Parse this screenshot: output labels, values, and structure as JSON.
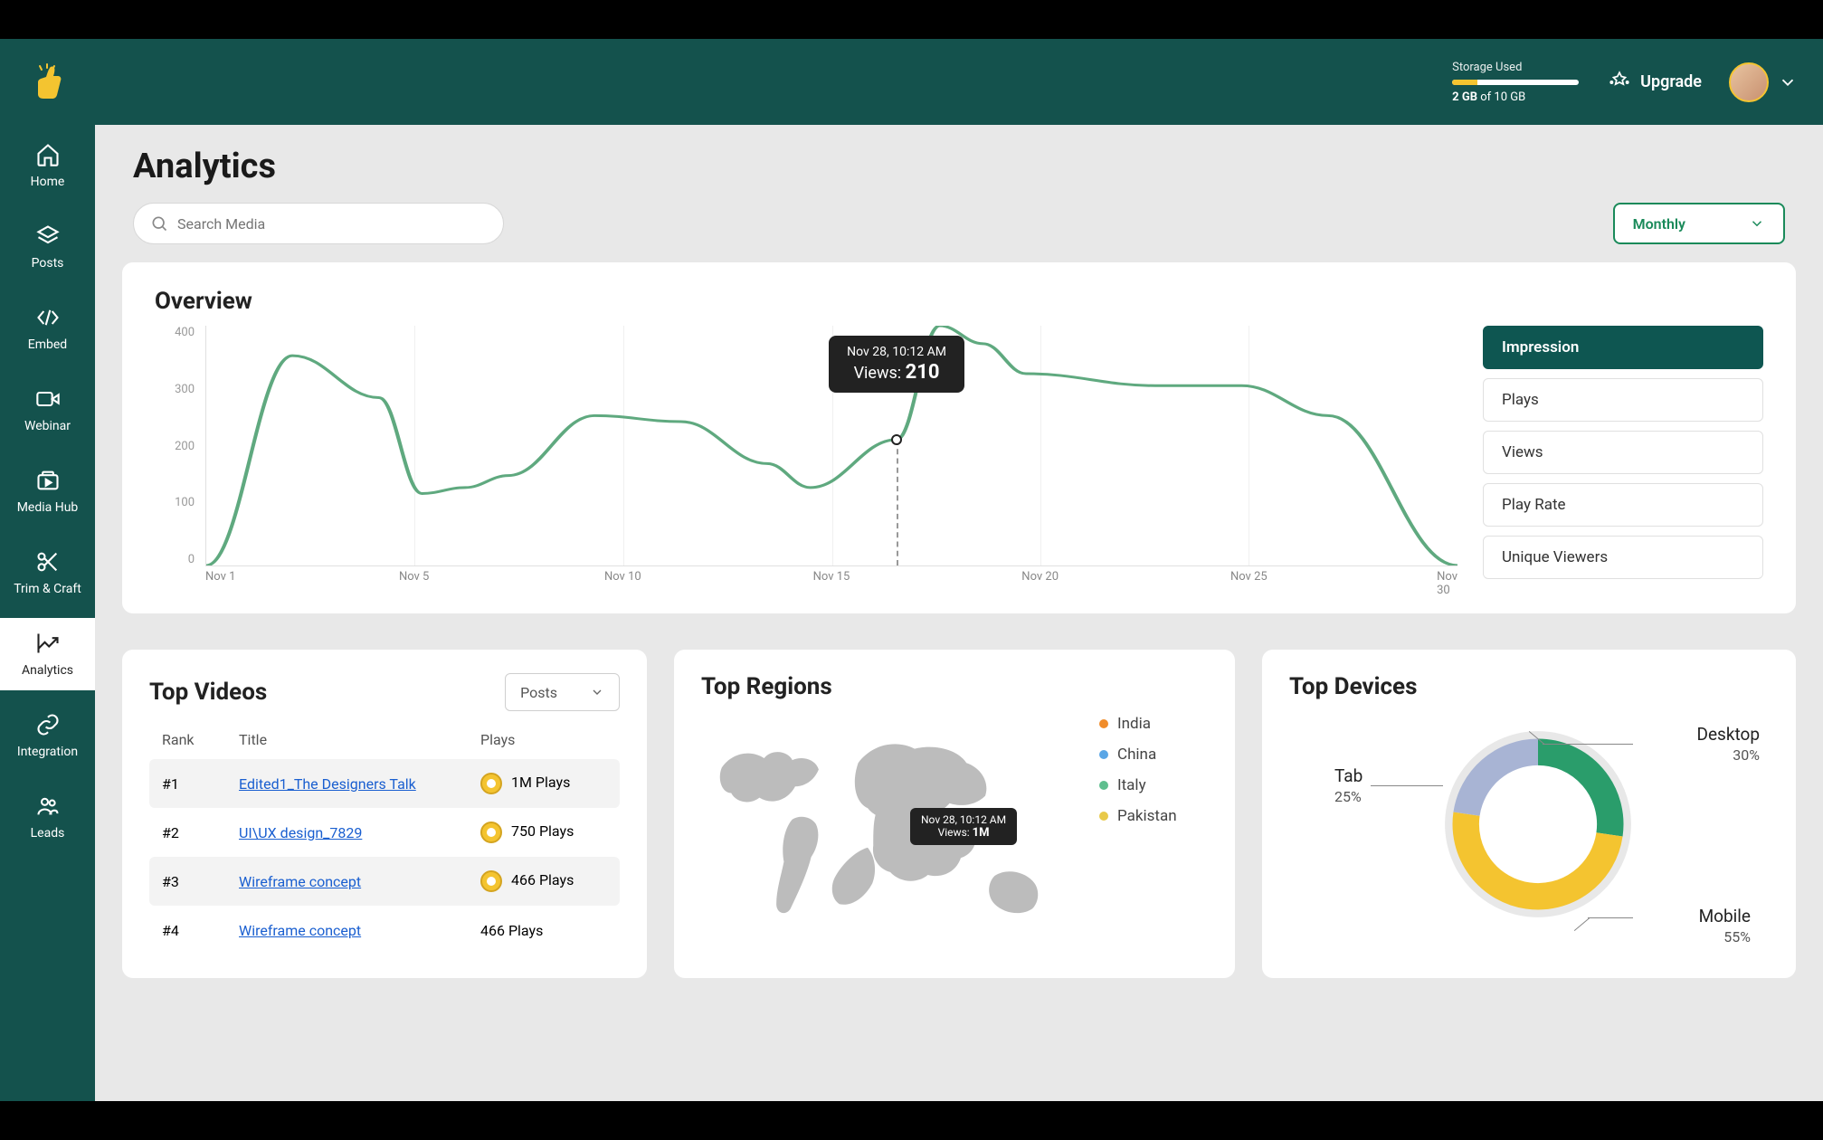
{
  "header": {
    "storage_label": "Storage Used",
    "storage_used": "2 GB",
    "storage_of": " of 10 GB",
    "storage_pct": 20,
    "upgrade": "Upgrade"
  },
  "sidebar": {
    "items": [
      {
        "label": "Home"
      },
      {
        "label": "Posts"
      },
      {
        "label": "Embed"
      },
      {
        "label": "Webinar"
      },
      {
        "label": "Media Hub"
      },
      {
        "label": "Trim & Craft"
      },
      {
        "label": "Analytics"
      },
      {
        "label": "Integration"
      },
      {
        "label": "Leads"
      }
    ]
  },
  "page": {
    "title": "Analytics",
    "search_placeholder": "Search Media",
    "period": "Monthly"
  },
  "overview": {
    "title": "Overview",
    "metrics": [
      "Impression",
      "Plays",
      "Views",
      "Play Rate",
      "Unique Viewers"
    ],
    "tooltip": {
      "time": "Nov 28, 10:12 AM",
      "label": "Views: ",
      "value": "210"
    }
  },
  "chart_data": {
    "type": "line",
    "title": "Overview",
    "xlabel": "",
    "ylabel": "",
    "ylim": [
      0,
      400
    ],
    "y_ticks": [
      400,
      300,
      200,
      100,
      0
    ],
    "categories": [
      "Nov 1",
      "Nov 5",
      "Nov 10",
      "Nov 15",
      "Nov 20",
      "Nov 25",
      "Nov 30"
    ],
    "x_days": [
      1,
      3,
      5,
      6,
      7,
      8,
      10,
      12,
      14,
      15,
      17,
      18,
      19,
      20,
      23,
      25,
      27,
      30
    ],
    "values": [
      0,
      350,
      280,
      120,
      130,
      150,
      250,
      240,
      170,
      130,
      210,
      400,
      370,
      320,
      300,
      300,
      250,
      0
    ],
    "tooltip_point": {
      "x_day": 17,
      "value": 210,
      "time": "Nov 28, 10:12 AM"
    }
  },
  "top_videos": {
    "title": "Top Videos",
    "dropdown": "Posts",
    "columns": {
      "rank": "Rank",
      "title": "Title",
      "plays": "Plays"
    },
    "rows": [
      {
        "rank": "#1",
        "title": "Edited1_The Designers Talk",
        "plays": "1M Plays",
        "medal": true
      },
      {
        "rank": "#2",
        "title": "UI\\UX design_7829",
        "plays": "750 Plays",
        "medal": true
      },
      {
        "rank": "#3",
        "title": "Wireframe concept",
        "plays": "466 Plays",
        "medal": true
      },
      {
        "rank": "#4",
        "title": "Wireframe concept",
        "plays": "466 Plays",
        "medal": false
      }
    ]
  },
  "top_regions": {
    "title": "Top Regions",
    "legend": [
      {
        "label": "India",
        "color": "#f08c2a"
      },
      {
        "label": "China",
        "color": "#5aa6e6"
      },
      {
        "label": "Italy",
        "color": "#5fbf8f"
      },
      {
        "label": "Pakistan",
        "color": "#e8c94a"
      }
    ],
    "tooltip": {
      "time": "Nov 28, 10:12 AM",
      "label": "Views: ",
      "value": "1M"
    }
  },
  "top_devices": {
    "title": "Top Devices",
    "items": [
      {
        "label": "Desktop",
        "pct": "30%",
        "value": 30,
        "color": "#2a9d6b"
      },
      {
        "label": "Mobile",
        "pct": "55%",
        "value": 55,
        "color": "#f4c430"
      },
      {
        "label": "Tab",
        "pct": "25%",
        "value": 25,
        "color": "#a8b4d4"
      }
    ]
  }
}
